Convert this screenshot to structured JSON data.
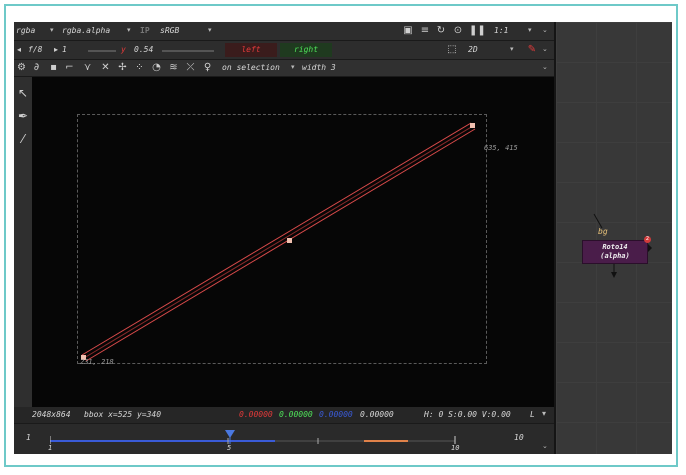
{
  "viewer": {
    "channels": "rgba",
    "channel_select": "rgba.alpha",
    "ip_label": "IP",
    "colorspace": "sRGB",
    "zoom": "1:1",
    "fstop": "f/8",
    "frame": "1",
    "gamma_label": "y",
    "gamma_value": "0.54",
    "left_label": "left",
    "right_label": "right",
    "view_mode": "2D",
    "stroke_mode": "on selection",
    "stroke_width": "width 3"
  },
  "canvas": {
    "coord_top_right": "635, 415",
    "coord_bottom_left": "231, 218"
  },
  "status": {
    "format": "2048x864",
    "bbox": "bbox x=525 y=340",
    "r": "0.00000",
    "g": "0.00000",
    "b": "0.00000",
    "a": "0.00000",
    "hsv": "H:  0 S:0.00 V:0.00",
    "l_label": "L"
  },
  "timeline": {
    "start": "1",
    "end": "10",
    "tick_1": "1",
    "tick_5": "5",
    "tick_10": "10",
    "current_frame": 5
  },
  "nodegraph": {
    "bg_label": "bg",
    "node_name": "Roto14",
    "node_sub": "(alpha)",
    "badge": "2"
  },
  "colors": {
    "accent_red": "#e23a3a",
    "accent_green": "#4fe35a",
    "accent_blue": "#3a5bd8",
    "node_purple": "#4a1d4a",
    "roto_stroke": "#d94a4a"
  }
}
